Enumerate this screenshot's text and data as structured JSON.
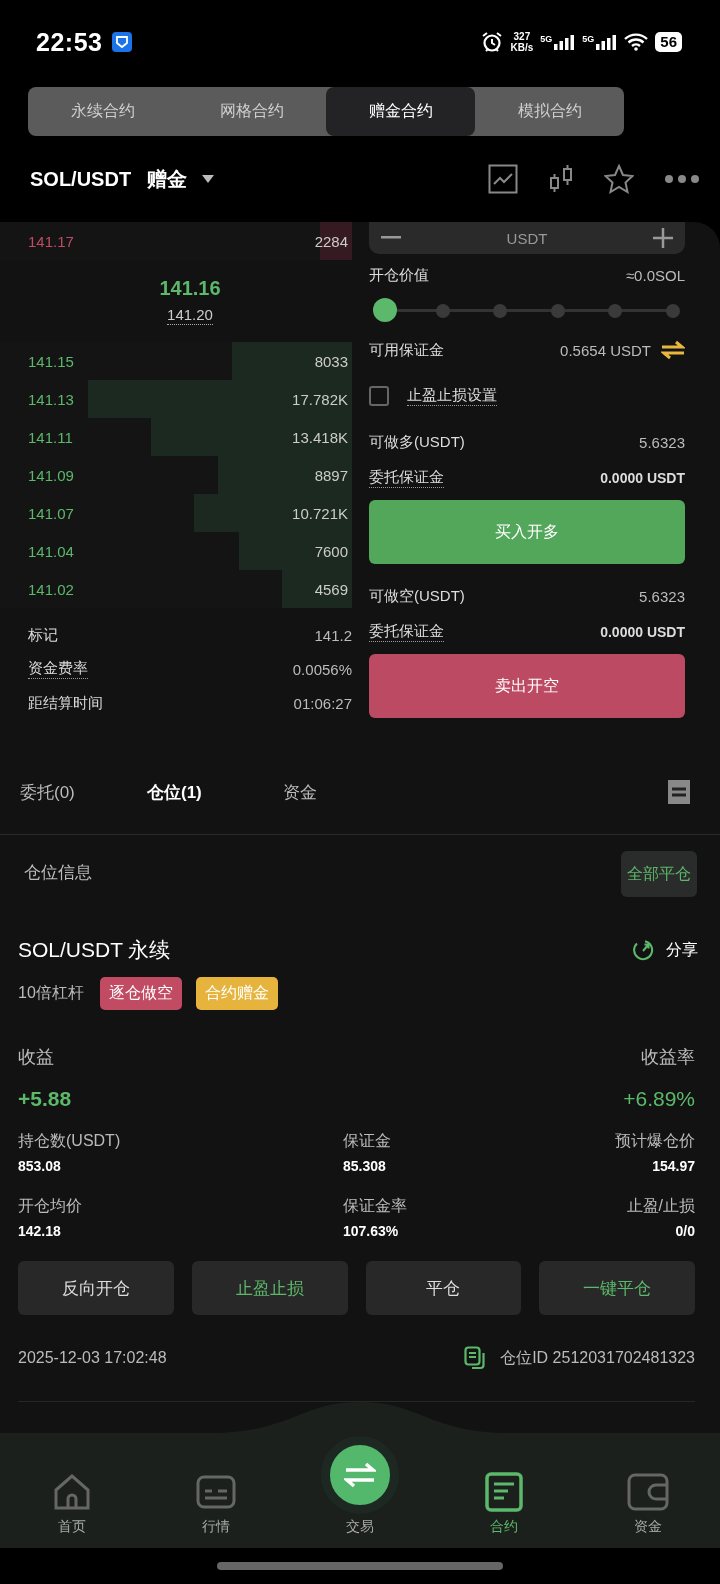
{
  "status_bar": {
    "time": "22:53",
    "net_speed": "327",
    "net_unit": "KB/s",
    "sim1": "5G",
    "sim2": "5G",
    "battery": "56"
  },
  "mode_tabs": [
    {
      "label": "永续合约",
      "selected": false
    },
    {
      "label": "网格合约",
      "selected": false
    },
    {
      "label": "赠金合约",
      "selected": true
    },
    {
      "label": "模拟合约",
      "selected": false
    }
  ],
  "pair": {
    "symbol": "SOL/USDT",
    "mode": "赠金"
  },
  "order_book": {
    "asks": [
      {
        "price": "141.17",
        "amount": "2284",
        "level": 0.09
      }
    ],
    "last_price": "141.16",
    "mark_price": "141.20",
    "bids": [
      {
        "price": "141.15",
        "amount": "8033",
        "level": 0.34
      },
      {
        "price": "141.13",
        "amount": "17.782K",
        "level": 0.75
      },
      {
        "price": "141.11",
        "amount": "13.418K",
        "level": 0.57
      },
      {
        "price": "141.09",
        "amount": "8897",
        "level": 0.38
      },
      {
        "price": "141.07",
        "amount": "10.721K",
        "level": 0.45
      },
      {
        "price": "141.04",
        "amount": "7600",
        "level": 0.32
      },
      {
        "price": "141.02",
        "amount": "4569",
        "level": 0.2
      }
    ],
    "stats": [
      {
        "label": "标记",
        "value": "141.2",
        "hint": false
      },
      {
        "label": "资金费率",
        "value": "0.0056%",
        "hint": true
      },
      {
        "label": "距结算时间",
        "value": "01:06:27",
        "hint": false
      }
    ]
  },
  "order_form": {
    "amount_unit": "USDT",
    "value_label": "开仓价值",
    "value": "≈0.0SOL",
    "leverage_slider": {
      "level": 0
    },
    "available": {
      "label": "可用保证金",
      "value": "0.5654 USDT"
    },
    "tpsl": {
      "label": "止盈止损设置",
      "checked": false
    },
    "sides": [
      {
        "kind": "buy",
        "max_label": "可做多(USDT)",
        "max_value": "5.6323",
        "margin_label": "委托保证金",
        "margin_value": "0.0000 USDT",
        "button": "买入开多"
      },
      {
        "kind": "sell",
        "max_label": "可做空(USDT)",
        "max_value": "5.6323",
        "margin_label": "委托保证金",
        "margin_value": "0.0000 USDT",
        "button": "卖出开空"
      }
    ]
  },
  "position_tabs": [
    {
      "label": "委托(0)",
      "selected": false
    },
    {
      "label": "仓位(1)",
      "selected": true
    },
    {
      "label": "资金",
      "selected": false
    }
  ],
  "positions": {
    "title": "仓位信息",
    "close_all": "全部平仓",
    "items": [
      {
        "symbol": "SOL/USDT 永续",
        "share": "分享",
        "leverage": "10倍杠杆",
        "tags": [
          {
            "label": "逐仓做空",
            "color": "#c04b63"
          },
          {
            "label": "合约赠金",
            "color": "#e6b43c"
          }
        ],
        "pnl_label": "收益",
        "pnl": "+5.88",
        "roe_label": "收益率",
        "roe": "+6.89%",
        "fields": [
          {
            "label": "持仓数(USDT)",
            "value": "853.08"
          },
          {
            "label": "保证金",
            "value": "85.308"
          },
          {
            "label": "预计爆仓价",
            "value": "154.97"
          },
          {
            "label": "开仓均价",
            "value": "142.18"
          },
          {
            "label": "保证金率",
            "value": "107.63%"
          },
          {
            "label": "止盈/止损",
            "value": "0/0"
          }
        ],
        "actions": [
          {
            "label": "反向开仓",
            "accent": false
          },
          {
            "label": "止盈止损",
            "accent": true
          },
          {
            "label": "平仓",
            "accent": false
          },
          {
            "label": "一键平仓",
            "accent": true
          }
        ],
        "opened_at": "2025-12-03 17:02:48",
        "id_label": "仓位ID 2512031702481323"
      }
    ]
  },
  "nav": [
    {
      "label": "首页",
      "kind": "tab",
      "selected": false
    },
    {
      "label": "行情",
      "kind": "tab",
      "selected": false
    },
    {
      "label": "交易",
      "kind": "center",
      "selected": false
    },
    {
      "label": "合约",
      "kind": "tab",
      "selected": true
    },
    {
      "label": "资金",
      "kind": "tab",
      "selected": false
    }
  ]
}
